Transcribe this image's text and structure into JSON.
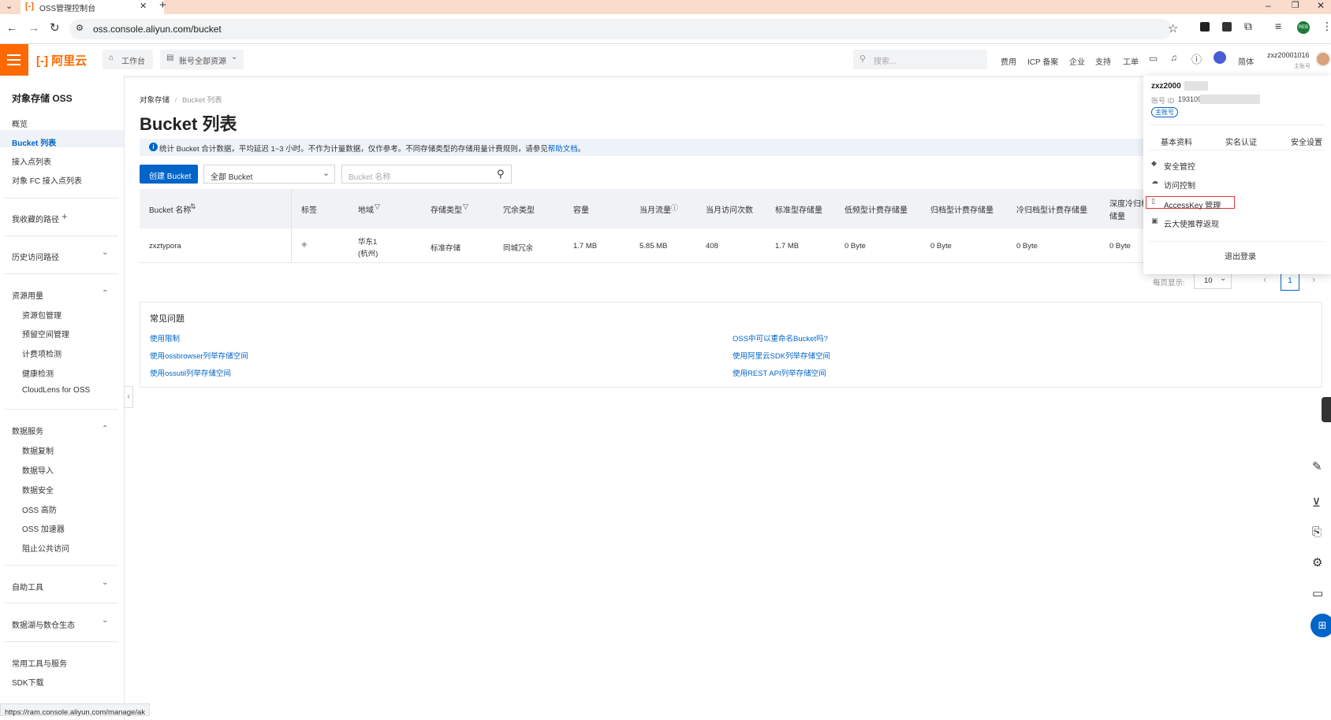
{
  "browser": {
    "tab_title": "OSS管理控制台",
    "new_tab": "+",
    "url": "oss.console.aliyun.com/bucket",
    "minimize": "–",
    "restore": "❐",
    "close": "✕",
    "profile_badge": "REB"
  },
  "topnav": {
    "logo_text": "阿里云",
    "workbench": "工作台",
    "resources": "账号全部资源",
    "search_placeholder": "搜索...",
    "links": [
      "费用",
      "ICP 备案",
      "企业",
      "支持",
      "工单"
    ],
    "lang": "简体",
    "username": "zxz20001016",
    "account_type": "主账号"
  },
  "sidebar": {
    "title": "对象存储 OSS",
    "items": [
      "概览",
      "Bucket 列表",
      "接入点列表",
      "对象 FC 接入点列表"
    ],
    "favorites": "我收藏的路径",
    "history": "历史访问路径",
    "resource_usage": {
      "label": "资源用量",
      "items": [
        "资源包管理",
        "预留空间管理",
        "计费项检测",
        "健康检测",
        "CloudLens for OSS"
      ]
    },
    "data_services": {
      "label": "数据服务",
      "items": [
        "数据复制",
        "数据导入",
        "数据安全",
        "OSS 高防",
        "OSS 加速器",
        "阻止公共访问"
      ]
    },
    "self_tools": "自助工具",
    "datalake": "数据湖与数仓生态",
    "common_tools": "常用工具与服务",
    "sdk": "SDK下载"
  },
  "main": {
    "breadcrumb_root": "对象存储",
    "breadcrumb_sep": "/",
    "breadcrumb_current": "Bucket 列表",
    "title": "Bucket 列表",
    "notice": "统计 Bucket 合计数据，平均延迟 1~3 小时。不作为计量数据，仅作参考。不同存储类型的存储用量计费规则，请参见",
    "notice_link": "帮助文档",
    "notice_end": "。",
    "create_button": "创建 Bucket",
    "filter_select": "全部 Bucket",
    "search_placeholder": "Bucket 名称",
    "table": {
      "headers": [
        "Bucket 名称",
        "标签",
        "地域",
        "存储类型",
        "冗余类型",
        "容量",
        "当月流量",
        "当月访问次数",
        "标准型存储量",
        "低频型计费存储量",
        "归档型计费存储量",
        "冷归档型计费存储量",
        "深度冷归档",
        "储量"
      ],
      "row": {
        "name": "zxztypora",
        "region_line1": "华东1",
        "region_line2": "(杭州)",
        "storage_type": "标准存储",
        "redundancy": "同城冗余",
        "capacity": "1.7 MB",
        "traffic": "5.85 MB",
        "visits": "408",
        "standard": "1.7 MB",
        "ia": "0 Byte",
        "archive": "0 Byte",
        "cold_archive": "0 Byte",
        "deep_cold": "0 Byte"
      }
    },
    "page_size_label": "每页显示:",
    "page_size": "10",
    "current_page": "1",
    "faq": {
      "title": "常见问题",
      "left": [
        "使用限制",
        "使用ossbrowser列举存储空间",
        "使用ossutil列举存储空间"
      ],
      "right": [
        "OSS中可以重命名Bucket吗?",
        "使用阿里云SDK列举存储空间",
        "使用REST API列举存储空间"
      ]
    }
  },
  "popup": {
    "username": "zxz2000",
    "account_id_label": "账号 ID",
    "account_id": "193109",
    "main_badge": "主账号",
    "tabs": [
      "基本资料",
      "实名认证",
      "安全设置"
    ],
    "items": [
      "安全管控",
      "访问控制",
      "AccessKey 管理",
      "云大使推荐返现"
    ],
    "logout": "退出登录"
  },
  "status_url": "https://ram.console.aliyun.com/manage/ak",
  "colors": {
    "accent": "#ff6a00",
    "link": "#0064c8",
    "primary_button": "#0064c8",
    "highlight_border": "#e3342f"
  }
}
